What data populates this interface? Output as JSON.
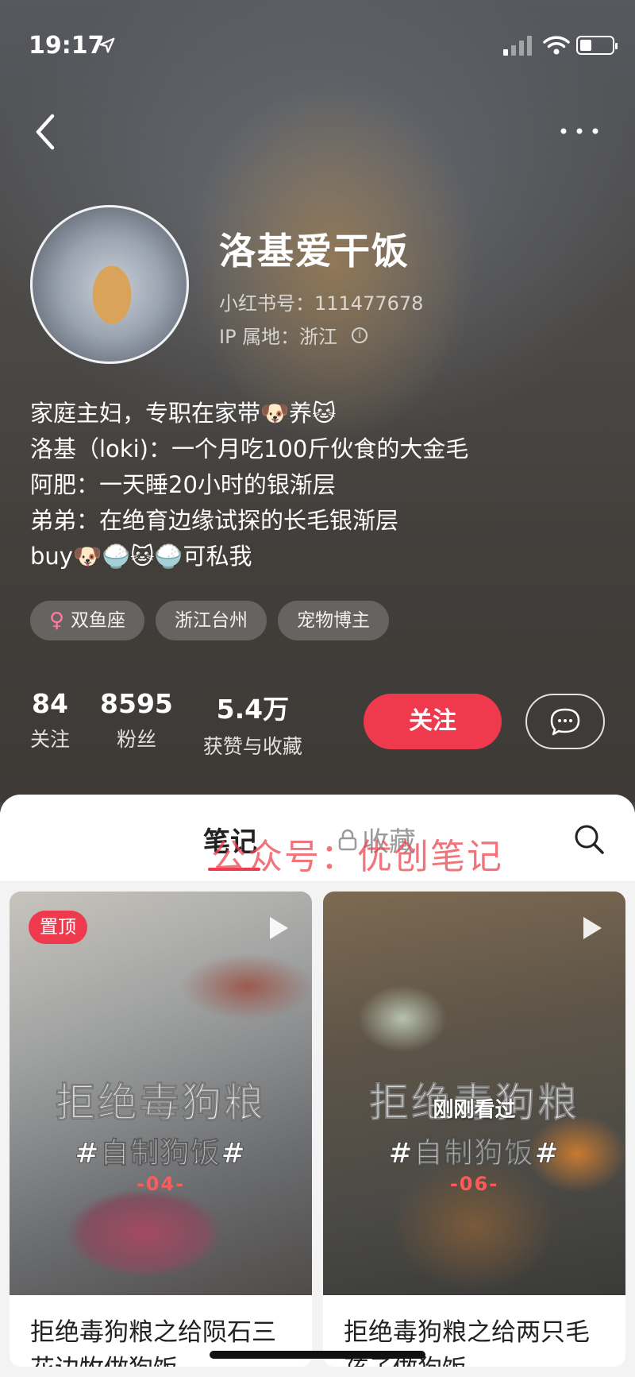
{
  "status_bar": {
    "time": "19:17"
  },
  "profile": {
    "name": "洛基爱干饭",
    "user_id": "小红书号：111477678",
    "ip_location": "IP 属地：浙江",
    "bio": [
      "家庭主妇，专职在家带🐶养🐱",
      "洛基（loki)：一个月吃100斤伙食的大金毛",
      "阿肥：一天睡20小时的银渐层",
      "弟弟：在绝育边缘试探的长毛银渐层",
      "buy🐶🍚🐱🍚可私我"
    ],
    "tags": [
      {
        "label": "双鱼座",
        "icon": "female-icon"
      },
      {
        "label": "浙江台州"
      },
      {
        "label": "宠物博主"
      }
    ],
    "stats": [
      {
        "value": "84",
        "label": "关注"
      },
      {
        "value": "8595",
        "label": "粉丝"
      },
      {
        "value": "5.4万",
        "label": "获赞与收藏"
      }
    ],
    "follow_label": "关注"
  },
  "tabs": {
    "notes": "笔记",
    "favorites": "收藏",
    "watermark": "公众号：优创笔记"
  },
  "notes": [
    {
      "badge": "置顶",
      "overlay_title": "拒绝毒狗粮",
      "overlay_sub": "#自制狗饭#",
      "overlay_num": "-04-",
      "title": "拒绝毒狗粮之给陨石三花边牧做狗饭"
    },
    {
      "recent": "刚刚看过",
      "overlay_title": "拒绝毒狗粮",
      "overlay_sub": "#自制狗饭#",
      "overlay_num": "-06-",
      "title": "拒绝毒狗粮之给两只毛孩子做狗饭"
    }
  ],
  "colors": {
    "accent": "#ef3a4e"
  }
}
